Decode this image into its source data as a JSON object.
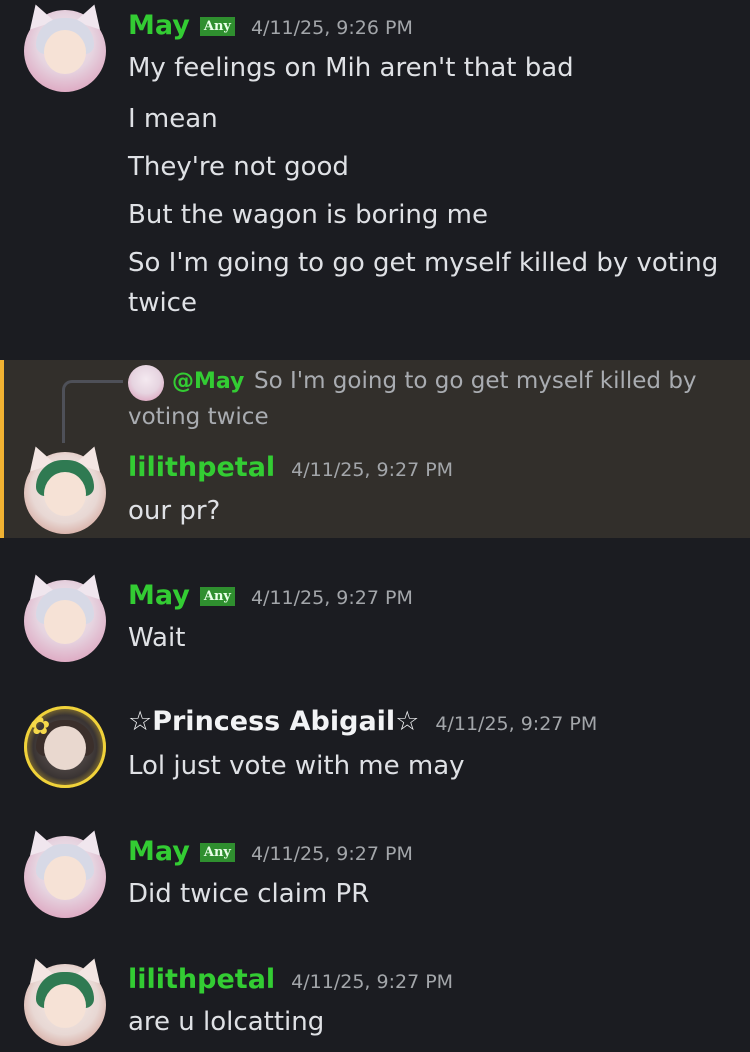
{
  "colors": {
    "background": "#1b1c21",
    "username_green": "#33cc33",
    "highlight_bg": "#322f2b",
    "highlight_bar": "#f0b232"
  },
  "messages": [
    {
      "author": "May",
      "tag": "Any",
      "time": "4/11/25, 9:26 PM",
      "lines": [
        "My feelings on Mih aren't that bad",
        "I mean",
        "They're not good",
        "But the wagon is boring me",
        "So I'm going to go get myself killed by voting",
        "twice"
      ]
    },
    {
      "author": "lilithpetal",
      "time": "4/11/25, 9:27 PM",
      "reply": {
        "mention": "@May",
        "text_line1": "So I'm going to go get myself killed by",
        "text_line2": "voting twice"
      },
      "lines": [
        "our pr?"
      ]
    },
    {
      "author": "May",
      "tag": "Any",
      "time": "4/11/25, 9:27 PM",
      "lines": [
        "Wait"
      ]
    },
    {
      "author": "☆Princess Abigail☆",
      "time": "4/11/25, 9:27 PM",
      "lines": [
        "Lol just vote with me may"
      ]
    },
    {
      "author": "May",
      "tag": "Any",
      "time": "4/11/25, 9:27 PM",
      "lines": [
        "Did twice claim PR"
      ]
    },
    {
      "author": "lilithpetal",
      "time": "4/11/25, 9:27 PM",
      "lines": [
        "are u lolcatting"
      ]
    }
  ]
}
